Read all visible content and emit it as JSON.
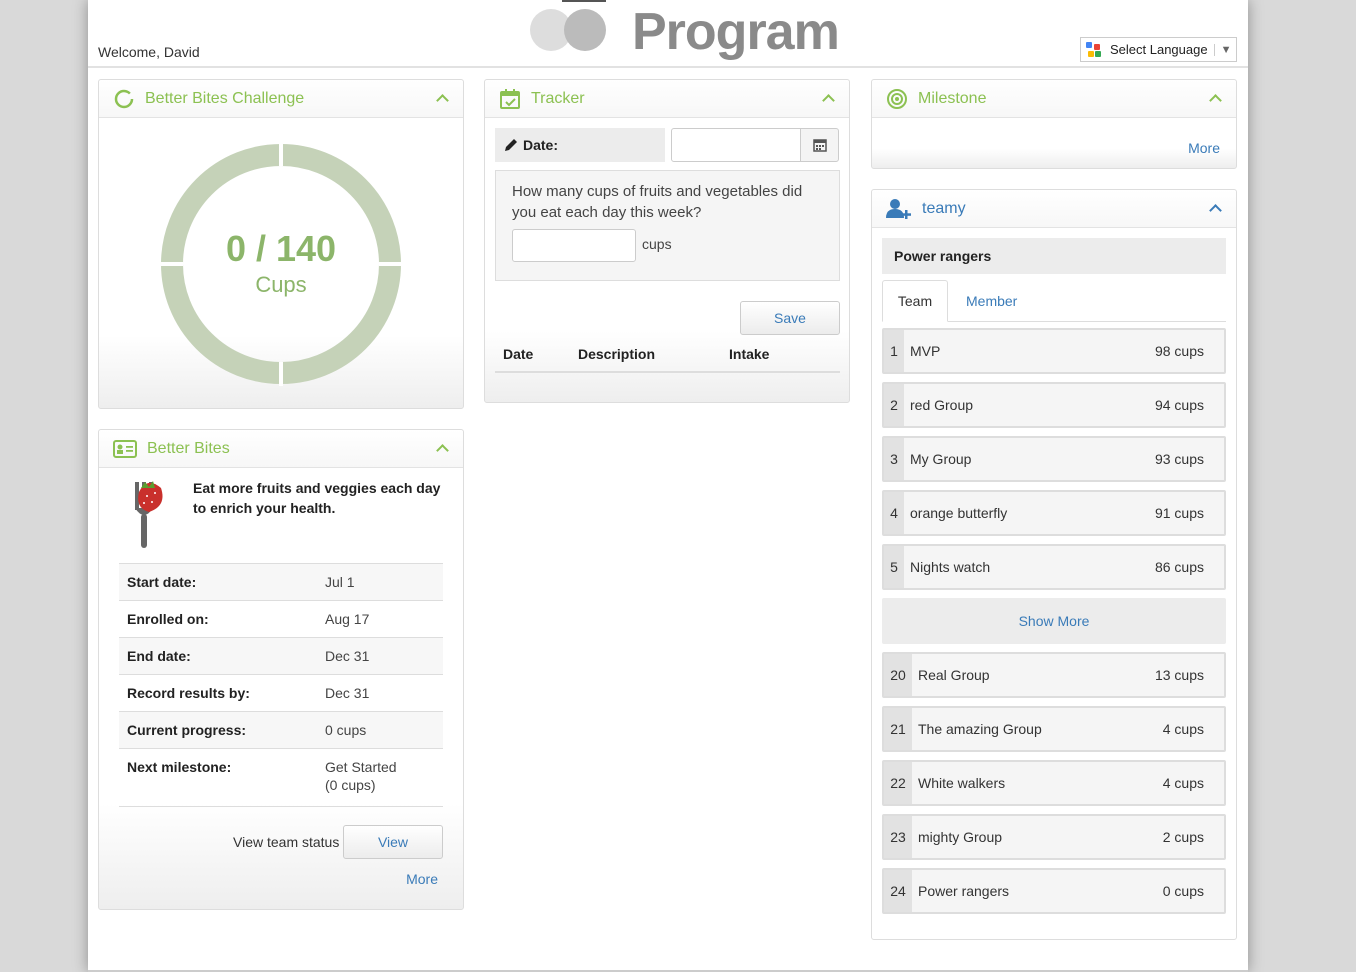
{
  "header": {
    "welcome": "Welcome, David",
    "logo_text": "Program",
    "language_select": "Select Language"
  },
  "challenge": {
    "title": "Better Bites Challenge",
    "progress_text": "0 / 140",
    "unit": "Cups",
    "progress_value": 0,
    "progress_total": 140
  },
  "better_bites": {
    "title": "Better Bites",
    "description": "Eat more fruits and veggies each day to enrich your health.",
    "rows": [
      {
        "label": "Start date:",
        "value": "Jul 1"
      },
      {
        "label": "Enrolled on:",
        "value": "Aug 17"
      },
      {
        "label": "End date:",
        "value": "Dec 31"
      },
      {
        "label": "Record results by:",
        "value": "Dec 31"
      },
      {
        "label": "Current progress:",
        "value": "0 cups"
      },
      {
        "label": "Next milestone:",
        "value": "Get Started",
        "value2": "(0 cups)"
      }
    ],
    "view_team_status": "View team status",
    "view_button": "View",
    "more": "More"
  },
  "tracker": {
    "title": "Tracker",
    "date_label": "Date:",
    "date_value": "",
    "question": "How many cups of fruits and vegetables did you eat each day this week?",
    "cups_value": "",
    "cups_label": "cups",
    "save_button": "Save",
    "columns": [
      "Date",
      "Description",
      "Intake"
    ]
  },
  "milestone": {
    "title": "Milestone",
    "more": "More"
  },
  "team": {
    "title": "teamy",
    "team_name": "Power rangers",
    "tabs": [
      "Team",
      "Member"
    ],
    "top": [
      {
        "rank": "1",
        "name": "MVP",
        "cups": "98 cups"
      },
      {
        "rank": "2",
        "name": "red Group",
        "cups": "94 cups"
      },
      {
        "rank": "3",
        "name": "My Group",
        "cups": "93 cups"
      },
      {
        "rank": "4",
        "name": "orange butterfly",
        "cups": "91 cups"
      },
      {
        "rank": "5",
        "name": "Nights watch",
        "cups": "86 cups"
      }
    ],
    "show_more": "Show More",
    "bottom": [
      {
        "rank": "20",
        "name": "Real Group",
        "cups": "13 cups"
      },
      {
        "rank": "21",
        "name": "The amazing Group",
        "cups": "4 cups"
      },
      {
        "rank": "22",
        "name": "White walkers",
        "cups": "4 cups"
      },
      {
        "rank": "23",
        "name": "mighty Group",
        "cups": "2 cups"
      },
      {
        "rank": "24",
        "name": "Power rangers",
        "cups": "0 cups"
      }
    ]
  },
  "colors": {
    "accent_green": "#8cc152",
    "link_blue": "#3a7bb8",
    "donut_ring": "#c5d2b8"
  }
}
